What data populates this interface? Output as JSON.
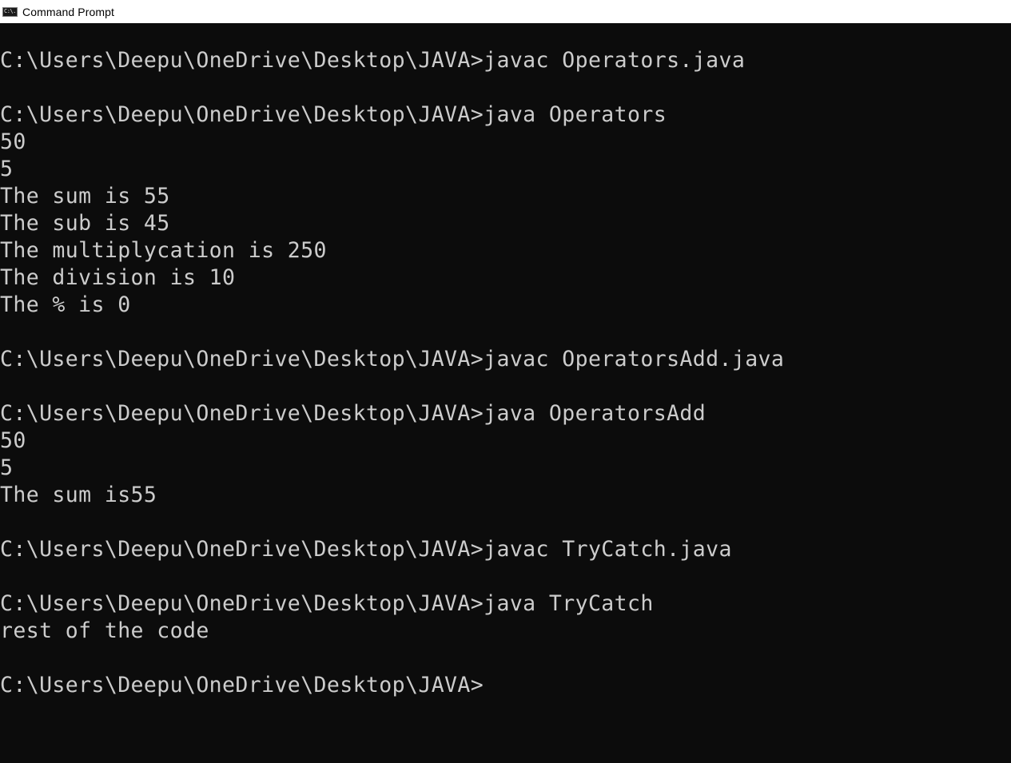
{
  "window": {
    "title": "Command Prompt",
    "icon": "cmd-icon",
    "icon_text": "C:\\."
  },
  "console": {
    "lines": [
      "C:\\Users\\Deepu\\OneDrive\\Desktop\\JAVA>javac Operators.java",
      "",
      "C:\\Users\\Deepu\\OneDrive\\Desktop\\JAVA>java Operators",
      "50",
      "5",
      "The sum is 55",
      "The sub is 45",
      "The multiplycation is 250",
      "The division is 10",
      "The % is 0",
      "",
      "C:\\Users\\Deepu\\OneDrive\\Desktop\\JAVA>javac OperatorsAdd.java",
      "",
      "C:\\Users\\Deepu\\OneDrive\\Desktop\\JAVA>java OperatorsAdd",
      "50",
      "5",
      "The sum is55",
      "",
      "C:\\Users\\Deepu\\OneDrive\\Desktop\\JAVA>javac TryCatch.java",
      "",
      "C:\\Users\\Deepu\\OneDrive\\Desktop\\JAVA>java TryCatch",
      "rest of the code",
      "",
      "C:\\Users\\Deepu\\OneDrive\\Desktop\\JAVA>"
    ]
  },
  "colors": {
    "background": "#0c0c0c",
    "text": "#cccccc",
    "titlebar": "#ffffff"
  }
}
